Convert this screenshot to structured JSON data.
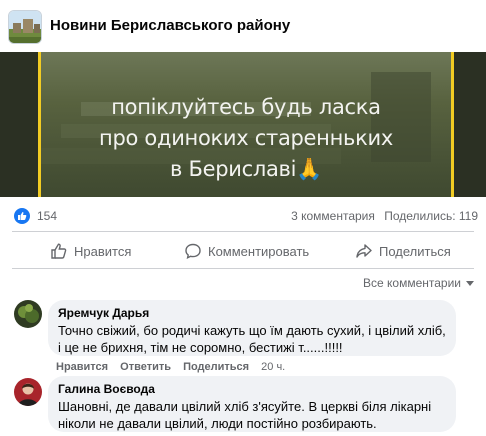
{
  "page": {
    "title": "Новини Бериславського району"
  },
  "post": {
    "image_text": [
      "попіклуйтесь будь ласка",
      "про одиноких старенньких",
      "в Бериславі"
    ],
    "image_emoji": "🙏",
    "frame_color": "#f2cc23"
  },
  "stats": {
    "likes": "154",
    "comments": "3 комментария",
    "shares": "Поделились: 119"
  },
  "actions": {
    "like": "Нравится",
    "comment": "Комментировать",
    "share": "Поделиться"
  },
  "comments_filter": "Все комментарии",
  "comments": [
    {
      "author": "Яремчук Дарья",
      "text": "Точно свіжий, бо родичі кажуть що їм дають сухий, і цвілий хліб, і це не брихня, тім не соромно, бестижі т......!!!!!",
      "like": "Нравится",
      "reply": "Ответить",
      "share": "Поделиться",
      "time": "20 ч."
    },
    {
      "author": "Галина Воєвода",
      "text": "Шановні, де давали цвілий хліб з'ясуйте. В церкві біля лікарні ніколи не давали цвілий, люди постійно розбирають."
    }
  ],
  "colors": {
    "accent": "#1877f2",
    "secondary_text": "#65676b",
    "bubble": "#f0f2f5"
  }
}
